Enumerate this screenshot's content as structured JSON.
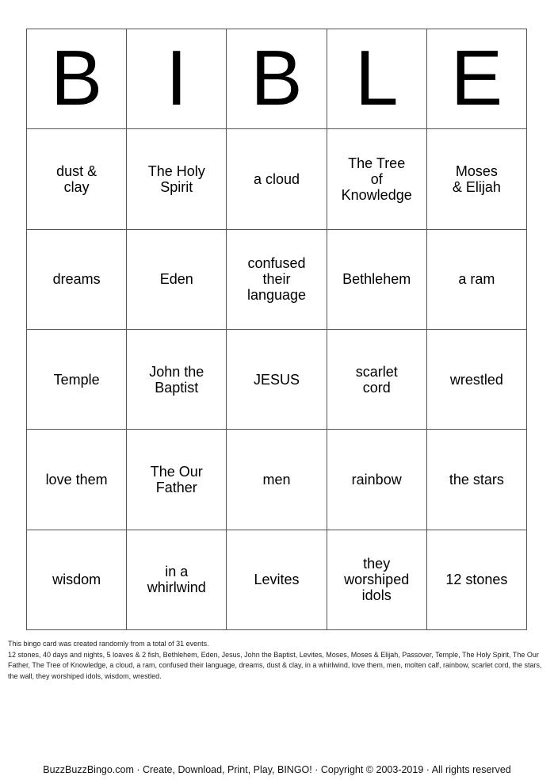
{
  "card": {
    "header": [
      "B",
      "I",
      "B",
      "L",
      "E"
    ],
    "rows": [
      [
        "dust &\nclay",
        "The Holy\nSpirit",
        "a cloud",
        "The Tree\nof\nKnowledge",
        "Moses\n& Elijah"
      ],
      [
        "dreams",
        "Eden",
        "confused\ntheir\nlanguage",
        "Bethlehem",
        "a ram"
      ],
      [
        "Temple",
        "John the\nBaptist",
        "JESUS",
        "scarlet\ncord",
        "wrestled"
      ],
      [
        "love them",
        "The Our\nFather",
        "men",
        "rainbow",
        "the stars"
      ],
      [
        "wisdom",
        "in a\nwhirlwind",
        "Levites",
        "they\nworshiped\nidols",
        "12 stones"
      ]
    ]
  },
  "info": {
    "intro": "This bingo card was created randomly from a total of 31 events.",
    "events": "12 stones, 40 days and nights, 5 loaves & 2 fish, Bethlehem, Eden, Jesus, John the Baptist, Levites, Moses, Moses & Elijah, Passover, Temple, The Holy Spirit, The Our Father, The Tree of Knowledge, a cloud, a ram, confused their language, dreams, dust & clay, in a whirlwind, love them, men, molten calf, rainbow, scarlet cord, the stars, the wall, they worshiped idols, wisdom, wrestled."
  },
  "footer": {
    "text": "BuzzBuzzBingo.com · Create, Download, Print, Play, BINGO! · Copyright © 2003-2019 · All rights reserved"
  }
}
